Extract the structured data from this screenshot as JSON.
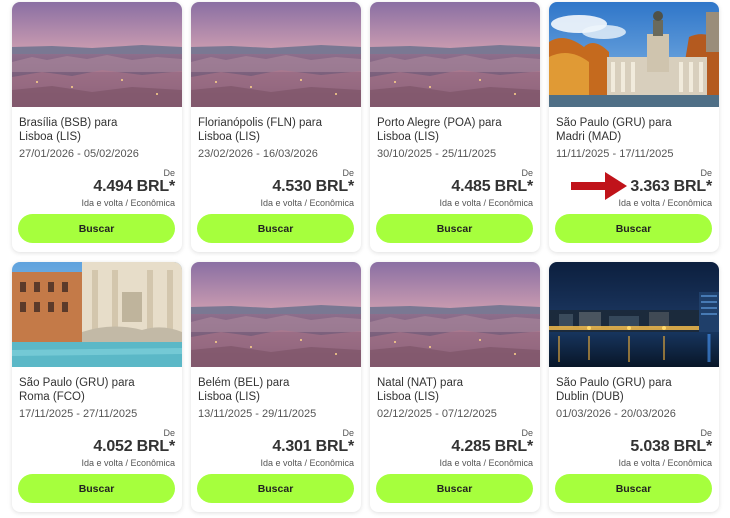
{
  "accent_color": "#a6ff3d",
  "arrow_color": "#c0131a",
  "cards": [
    {
      "route_line1": "Brasília (BSB) para",
      "route_line2": "Lisboa (LIS)",
      "dates": "27/01/2026 - 05/02/2026",
      "from_label": "De",
      "price": "4.494 BRL*",
      "fare_info": "Ida e volta / Econômica",
      "button_label": "Buscar",
      "image": "lisbon-city-photo"
    },
    {
      "route_line1": "Florianópolis (FLN) para",
      "route_line2": "Lisboa (LIS)",
      "dates": "23/02/2026 - 16/03/2026",
      "from_label": "De",
      "price": "4.530 BRL*",
      "fare_info": "Ida e volta / Econômica",
      "button_label": "Buscar",
      "image": "lisbon-city-photo"
    },
    {
      "route_line1": "Porto Alegre (POA) para",
      "route_line2": "Lisboa (LIS)",
      "dates": "30/10/2025 - 25/11/2025",
      "from_label": "De",
      "price": "4.485 BRL*",
      "fare_info": "Ida e volta / Econômica",
      "button_label": "Buscar",
      "image": "lisbon-city-photo"
    },
    {
      "route_line1": "São Paulo (GRU) para",
      "route_line2": "Madri (MAD)",
      "dates": "11/11/2025 - 17/11/2025",
      "from_label": "De",
      "price": "3.363 BRL*",
      "fare_info": "Ida e volta / Econômica",
      "button_label": "Buscar",
      "image": "madrid-monument-photo"
    },
    {
      "route_line1": "São Paulo (GRU) para",
      "route_line2": "Roma (FCO)",
      "dates": "17/11/2025 - 27/11/2025",
      "from_label": "De",
      "price": "4.052 BRL*",
      "fare_info": "Ida e volta / Econômica",
      "button_label": "Buscar",
      "image": "rome-fountain-photo"
    },
    {
      "route_line1": "Belém (BEL) para",
      "route_line2": "Lisboa (LIS)",
      "dates": "13/11/2025 - 29/11/2025",
      "from_label": "De",
      "price": "4.301 BRL*",
      "fare_info": "Ida e volta / Econômica",
      "button_label": "Buscar",
      "image": "lisbon-city-photo"
    },
    {
      "route_line1": "Natal (NAT) para",
      "route_line2": "Lisboa (LIS)",
      "dates": "02/12/2025 - 07/12/2025",
      "from_label": "De",
      "price": "4.285 BRL*",
      "fare_info": "Ida e volta / Econômica",
      "button_label": "Buscar",
      "image": "lisbon-city-photo"
    },
    {
      "route_line1": "São Paulo (GRU) para",
      "route_line2": "Dublin (DUB)",
      "dates": "01/03/2026 - 20/03/2026",
      "from_label": "De",
      "price": "5.038 BRL*",
      "fare_info": "Ida e volta / Econômica",
      "button_label": "Buscar",
      "image": "dublin-night-photo"
    }
  ]
}
